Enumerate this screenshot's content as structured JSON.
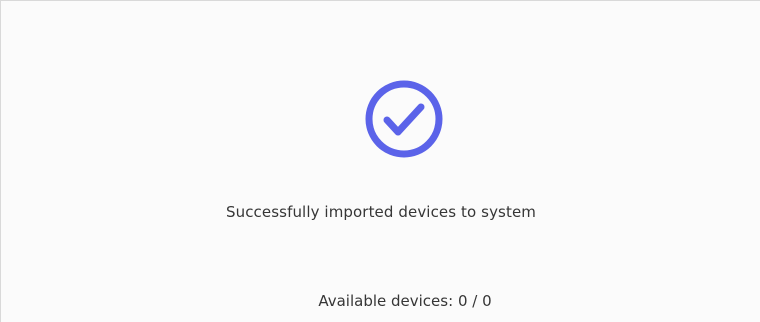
{
  "status": {
    "icon": "check-circle-icon",
    "accent_color": "#5b63e9",
    "message": "Successfully imported devices to system"
  },
  "devices": {
    "label": "Available devices:",
    "available": "0",
    "total": "0"
  }
}
